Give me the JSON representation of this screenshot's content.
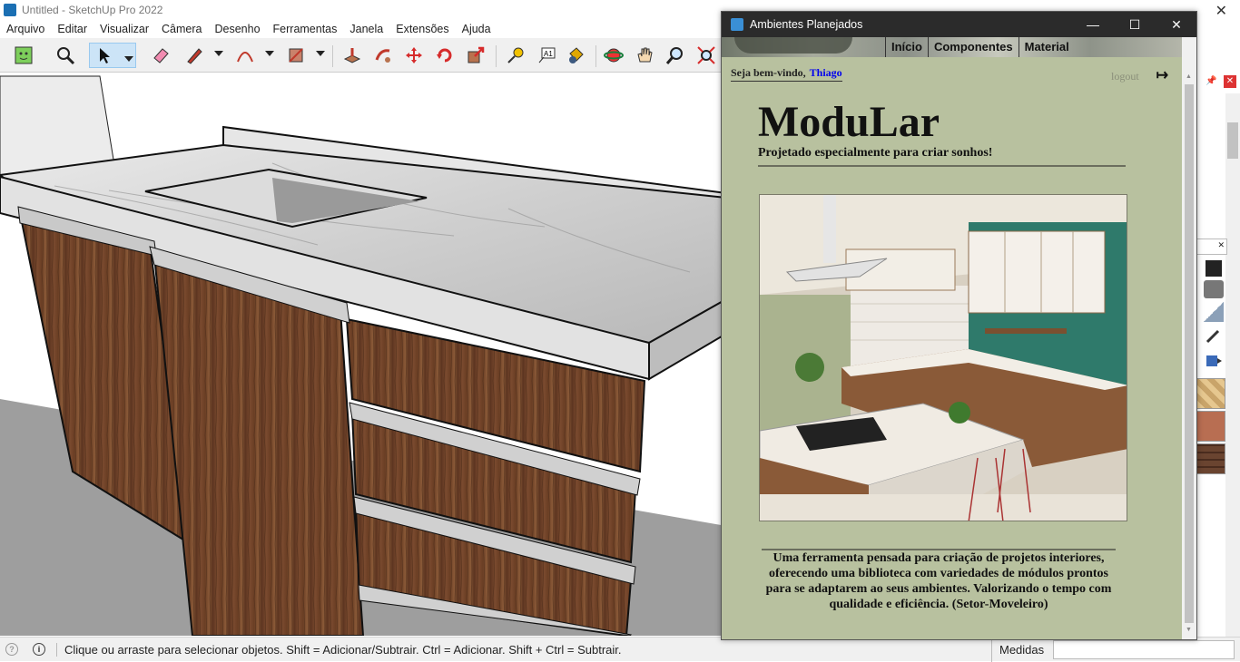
{
  "app": {
    "window_title": "Untitled - SketchUp Pro 2022"
  },
  "menu": [
    "Arquivo",
    "Editar",
    "Visualizar",
    "Câmera",
    "Desenho",
    "Ferramentas",
    "Janela",
    "Extensões",
    "Ajuda"
  ],
  "toolbar": {
    "tools": [
      "get-started-icon",
      "search-icon",
      "select-icon",
      "eraser-icon",
      "pencil-icon",
      "arc-icon",
      "rectangle-icon",
      "push-pull-icon",
      "follow-me-icon",
      "move-icon",
      "rotate-icon",
      "scale-icon",
      "tape-measure-icon",
      "text-icon",
      "paint-bucket-icon",
      "orbit-icon",
      "pan-icon",
      "zoom-icon",
      "zoom-extents-icon"
    ]
  },
  "status": {
    "message": "Clique ou arraste para selecionar objetos. Shift = Adicionar/Subtrair. Ctrl = Adicionar. Shift + Ctrl = Subtrair.",
    "measures_label": "Medidas"
  },
  "dialog": {
    "title": "Ambientes Planejados",
    "nav": [
      "Início",
      "Componentes",
      "Material"
    ],
    "welcome_text": "Seja bem-vindo,",
    "user_name": "Thiago",
    "logout_label": "logout",
    "brand": "ModuLar",
    "tagline": "Projetado especialmente para criar sonhos!",
    "description": "Uma ferramenta pensada para criação de projetos interiores, oferecendo uma biblioteca com variedades de módulos prontos para se adaptarem ao seus ambientes. Valorizando o tempo com qualidade e eficiência. (Setor-Moveleiro)"
  }
}
